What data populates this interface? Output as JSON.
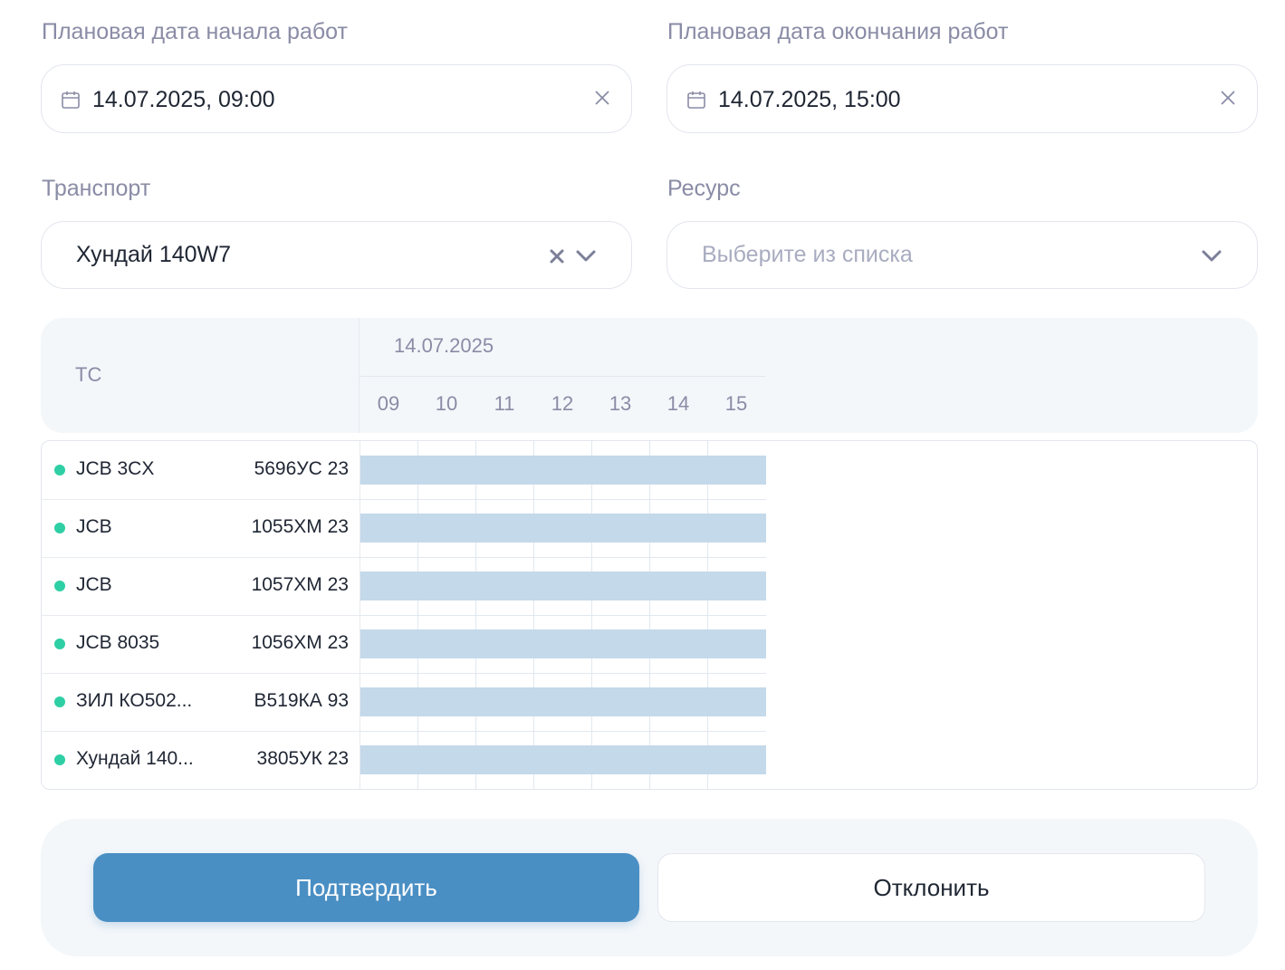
{
  "form": {
    "start_label": "Плановая дата начала работ",
    "start_value": "14.07.2025, 09:00",
    "end_label": "Плановая дата окончания работ",
    "end_value": "14.07.2025, 15:00",
    "transport_label": "Транспорт",
    "transport_value": "Хундай 140W7",
    "resource_label": "Ресурс",
    "resource_placeholder": "Выберите из списка"
  },
  "gantt": {
    "ts_header": "ТС",
    "date": "14.07.2025",
    "hours": [
      "09",
      "10",
      "11",
      "12",
      "13",
      "14",
      "15"
    ],
    "rows": [
      {
        "name": "JCB 3CX",
        "plate": "5696УС 23",
        "status": "active"
      },
      {
        "name": "JCB",
        "plate": "1055ХМ 23",
        "status": "active"
      },
      {
        "name": "JCB",
        "plate": "1057ХМ 23",
        "status": "active"
      },
      {
        "name": "JCB 8035",
        "plate": "1056ХМ 23",
        "status": "active"
      },
      {
        "name": "ЗИЛ КО502...",
        "plate": "В519КА 93",
        "status": "active"
      },
      {
        "name": "Хундай 140...",
        "plate": "3805УК 23",
        "status": "active"
      }
    ],
    "bar_color": "#c4d9ea",
    "status_color": "#2ecfa4"
  },
  "actions": {
    "confirm_label": "Подтвердить",
    "reject_label": "Отклонить",
    "confirm_color": "#4a8fc4"
  }
}
